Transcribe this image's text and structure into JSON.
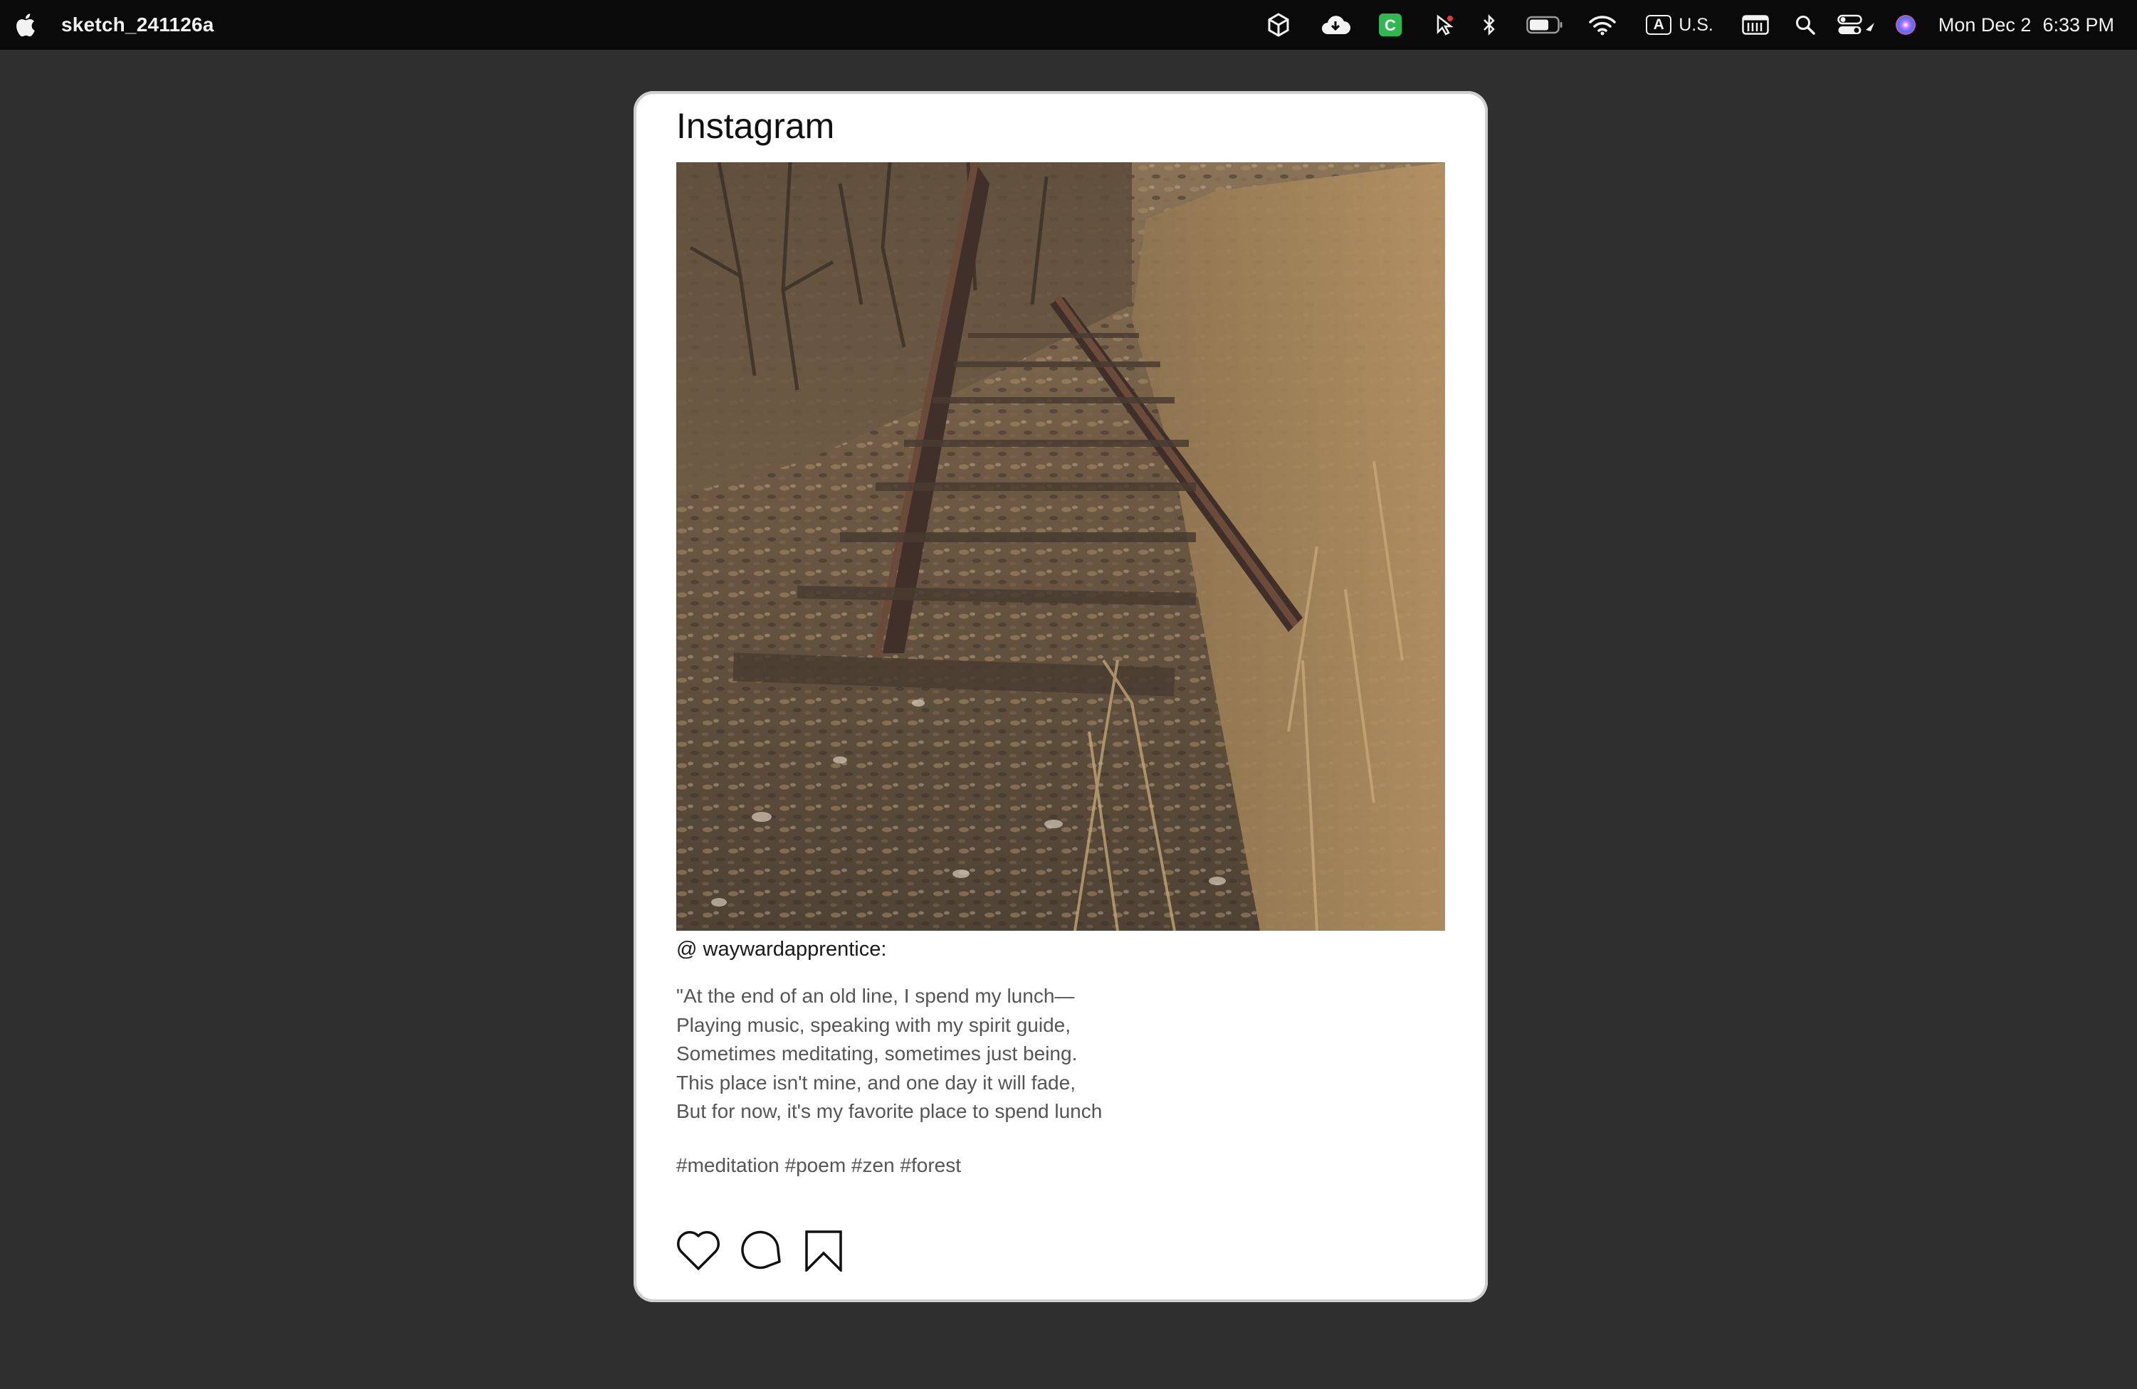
{
  "menubar": {
    "app_name": "sketch_241126a",
    "keyboard_badge": "A",
    "keyboard_layout": "U.S.",
    "date": "Mon Dec 2",
    "time": "6:33 PM",
    "icons": [
      "apple-icon",
      "unity-icon",
      "cloud-download-icon",
      "c-app-icon",
      "cursor-icon",
      "bluetooth-icon",
      "battery-icon",
      "wifi-icon",
      "keyboard-input-icon",
      "calendar-icon",
      "search-icon",
      "control-center-icon",
      "siri-icon"
    ],
    "accent_green": "#2fb84f"
  },
  "post": {
    "app_title": "Instagram",
    "username": "@ waywardapprentice:",
    "caption_lines": [
      "\"At the end of an old line, I spend my lunch—",
      "Playing music, speaking with my spirit guide,",
      "Sometimes meditating, sometimes just being.",
      "This place isn't mine, and one day it will fade,",
      "But for now, it's my favorite place to spend lunch"
    ],
    "hashtags": "#meditation #poem #zen #forest",
    "actions": [
      "heart-icon",
      "comment-icon",
      "bookmark-icon"
    ]
  }
}
